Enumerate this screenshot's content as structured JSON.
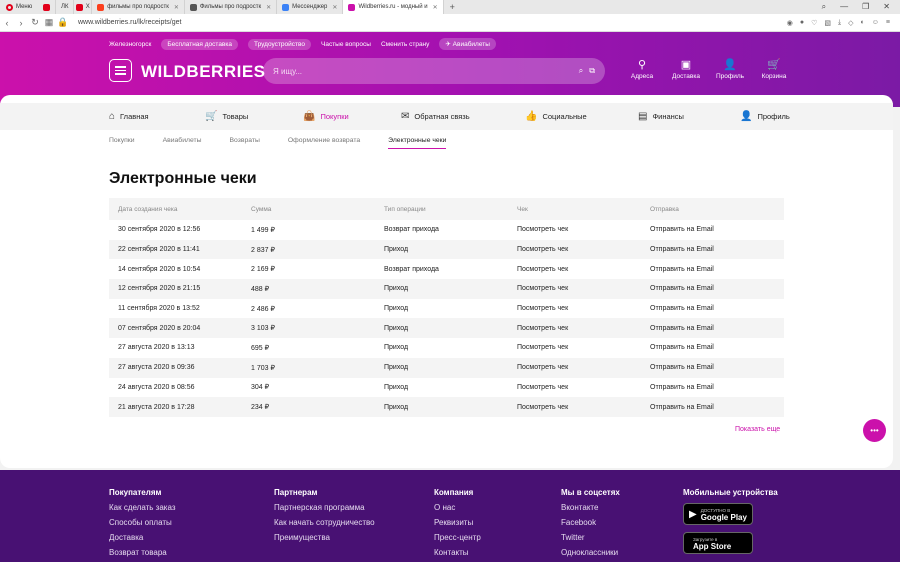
{
  "browser": {
    "menu_label": "Меню",
    "tabs": [
      {
        "label": "",
        "icon": "opera-red-icon",
        "color": "#e2001a"
      },
      {
        "label": "ЛК",
        "icon": "",
        "color": ""
      },
      {
        "label": "X",
        "icon": "x-icon",
        "color": "#e2001a"
      },
      {
        "label": "фильмы про подростк",
        "icon": "yandex-icon",
        "color": "#fc3f1d"
      },
      {
        "label": "Фильмы про подростк",
        "icon": "film-icon",
        "color": "#555555"
      },
      {
        "label": "Мессенджер",
        "icon": "messenger-icon",
        "color": "#3b82f6"
      },
      {
        "label": "Wildberries.ru - модный и",
        "icon": "wb-icon",
        "color": "#cb11ab"
      }
    ],
    "url": "www.wildberries.ru/lk/receipts/get"
  },
  "header": {
    "top_links": [
      {
        "label": "Железногорск",
        "pill": false
      },
      {
        "label": "Бесплатная доставка",
        "pill": true
      },
      {
        "label": "Трудоустройство",
        "pill": true
      },
      {
        "label": "Частые вопросы",
        "pill": false
      },
      {
        "label": "Сменить страну",
        "pill": false
      },
      {
        "label": "✈ Авиабилеты",
        "pill": true
      }
    ],
    "logo": "WILDBERRIES",
    "search_placeholder": "Я ищу...",
    "icons": [
      {
        "label": "Адреса",
        "icon": "location-pin-icon",
        "glyph": "⚲"
      },
      {
        "label": "Доставка",
        "icon": "box-icon",
        "glyph": "▣"
      },
      {
        "label": "Профиль",
        "icon": "user-icon",
        "glyph": "👤"
      },
      {
        "label": "Корзина",
        "icon": "cart-icon",
        "glyph": "🛒"
      }
    ],
    "gradient_start": "#cb11ab",
    "gradient_end": "#7b1aa5"
  },
  "nav": {
    "items": [
      {
        "label": "Главная",
        "icon": "home-icon",
        "glyph": "⌂",
        "active": false
      },
      {
        "label": "Товары",
        "icon": "cart-icon",
        "glyph": "🛒",
        "active": false
      },
      {
        "label": "Покупки",
        "icon": "bag-icon",
        "glyph": "👜",
        "active": true
      },
      {
        "label": "Обратная связь",
        "icon": "feedback-icon",
        "glyph": "✉",
        "active": false
      },
      {
        "label": "Социальные",
        "icon": "like-icon",
        "glyph": "👍",
        "active": false
      },
      {
        "label": "Финансы",
        "icon": "wallet-icon",
        "glyph": "▤",
        "active": false
      },
      {
        "label": "Профиль",
        "icon": "user-icon",
        "glyph": "👤",
        "active": false
      }
    ],
    "sub": [
      {
        "label": "Покупки",
        "active": false
      },
      {
        "label": "Авиабилеты",
        "active": false
      },
      {
        "label": "Возвраты",
        "active": false
      },
      {
        "label": "Оформление возврата",
        "active": false
      },
      {
        "label": "Электронные чеки",
        "active": true
      }
    ]
  },
  "page": {
    "title": "Электронные чеки",
    "columns": [
      "Дата создания чека",
      "Сумма",
      "Тип операции",
      "Чек",
      "Отправка"
    ],
    "rows": [
      [
        "30 сентября 2020 в 12:56",
        "1 499 ₽",
        "Возврат прихода",
        "Посмотреть чек",
        "Отправить на Email"
      ],
      [
        "22 сентября 2020 в 11:41",
        "2 837 ₽",
        "Приход",
        "Посмотреть чек",
        "Отправить на Email"
      ],
      [
        "14 сентября 2020 в 10:54",
        "2 169 ₽",
        "Возврат прихода",
        "Посмотреть чек",
        "Отправить на Email"
      ],
      [
        "12 сентября 2020 в 21:15",
        "488 ₽",
        "Приход",
        "Посмотреть чек",
        "Отправить на Email"
      ],
      [
        "11 сентября 2020 в 13:52",
        "2 486 ₽",
        "Приход",
        "Посмотреть чек",
        "Отправить на Email"
      ],
      [
        "07 сентября 2020 в 20:04",
        "3 103 ₽",
        "Приход",
        "Посмотреть чек",
        "Отправить на Email"
      ],
      [
        "27 августа 2020 в 13:13",
        "695 ₽",
        "Приход",
        "Посмотреть чек",
        "Отправить на Email"
      ],
      [
        "27 августа 2020 в 09:36",
        "1 703 ₽",
        "Приход",
        "Посмотреть чек",
        "Отправить на Email"
      ],
      [
        "24 августа 2020 в 08:56",
        "304 ₽",
        "Приход",
        "Посмотреть чек",
        "Отправить на Email"
      ],
      [
        "21 августа 2020 в 17:28",
        "234 ₽",
        "Приход",
        "Посмотреть чек",
        "Отправить на Email"
      ]
    ],
    "show_more": "Показать еще"
  },
  "footer": {
    "columns": [
      {
        "title": "Покупателям",
        "links": [
          "Как сделать заказ",
          "Способы оплаты",
          "Доставка",
          "Возврат товара"
        ]
      },
      {
        "title": "Партнерам",
        "links": [
          "Партнерская программа",
          "Как начать сотрудничество",
          "Преимущества"
        ]
      },
      {
        "title": "Компания",
        "links": [
          "О нас",
          "Реквизиты",
          "Пресс-центр",
          "Контакты"
        ]
      },
      {
        "title": "Мы в соцсетях",
        "links": [
          "Вконтакте",
          "Facebook",
          "Twitter",
          "Одноклассники"
        ]
      }
    ],
    "mobile_title": "Мобильные устройства",
    "stores": [
      {
        "line1": "ДОСТУПНО В",
        "line2": "Google Play",
        "icon": "google-play-icon",
        "glyph": "▶"
      },
      {
        "line1": "Загрузите в",
        "line2": "App Store",
        "icon": "apple-icon",
        "glyph": ""
      }
    ],
    "bg_color": "#481173"
  }
}
